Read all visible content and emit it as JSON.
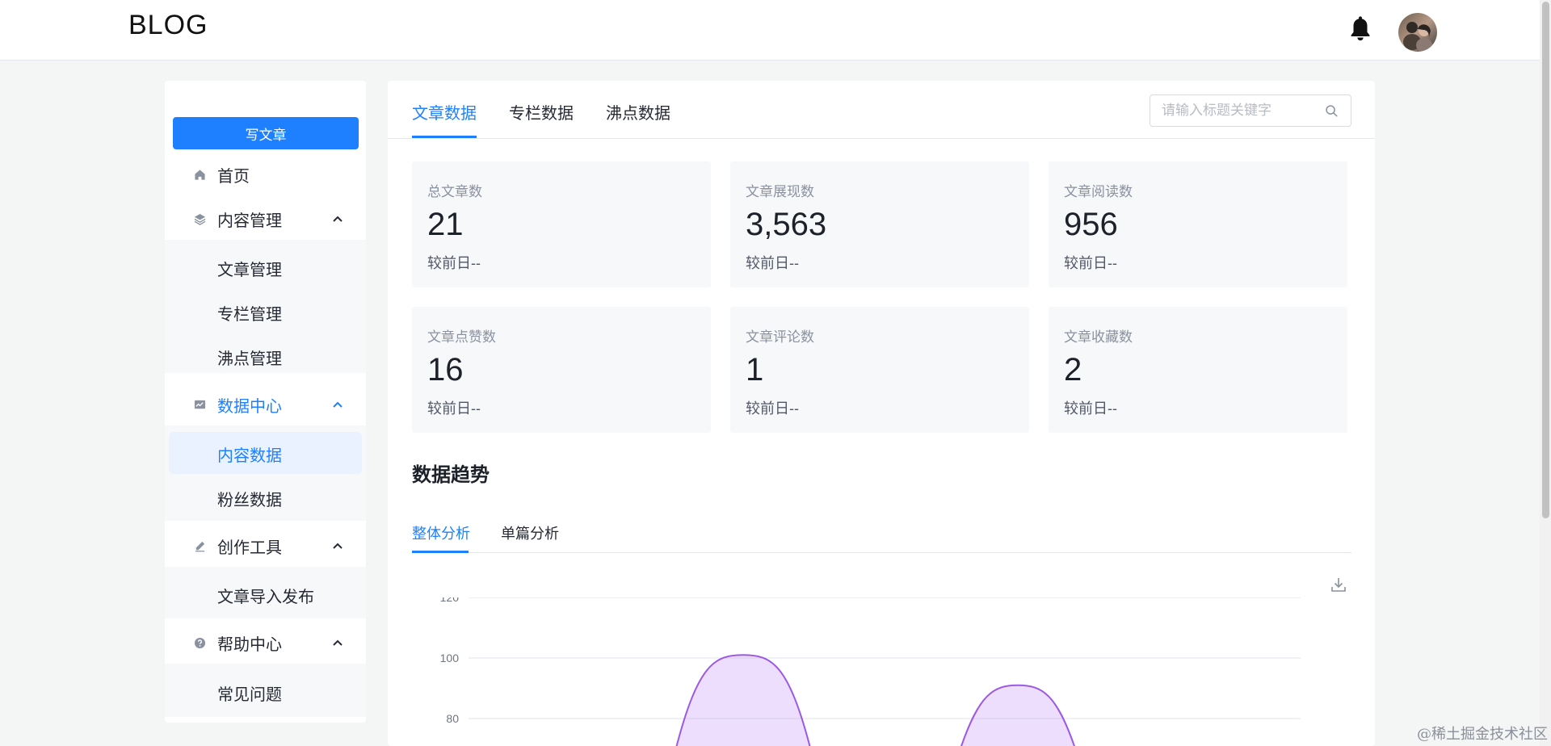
{
  "header": {
    "logo": "BLOG",
    "bell_icon": "bell-icon",
    "avatar": "user-avatar"
  },
  "sidebar": {
    "write_button": "写文章",
    "home": "首页",
    "content_mgmt": {
      "label": "内容管理",
      "items": [
        "文章管理",
        "专栏管理",
        "沸点管理"
      ]
    },
    "data_center": {
      "label": "数据中心",
      "items": [
        "内容数据",
        "粉丝数据"
      ]
    },
    "creation_tools": {
      "label": "创作工具",
      "items": [
        "文章导入发布"
      ]
    },
    "help_center": {
      "label": "帮助中心",
      "items": [
        "常见问题"
      ]
    }
  },
  "main": {
    "tabs": [
      "文章数据",
      "专栏数据",
      "沸点数据"
    ],
    "active_tab": 0,
    "search_placeholder": "请输入标题关键字",
    "stats": [
      {
        "label": "总文章数",
        "value": "21",
        "sub": "较前日--"
      },
      {
        "label": "文章展现数",
        "value": "3,563",
        "sub": "较前日--"
      },
      {
        "label": "文章阅读数",
        "value": "956",
        "sub": "较前日--"
      },
      {
        "label": "文章点赞数",
        "value": "16",
        "sub": "较前日--"
      },
      {
        "label": "文章评论数",
        "value": "1",
        "sub": "较前日--"
      },
      {
        "label": "文章收藏数",
        "value": "2",
        "sub": "较前日--"
      }
    ],
    "trend_title": "数据趋势",
    "subtabs": [
      "整体分析",
      "单篇分析"
    ]
  },
  "chart_data": {
    "type": "area",
    "y_ticks": [
      "120",
      "100",
      "80"
    ],
    "ylim": [
      80,
      120
    ],
    "visible_peaks": [
      101,
      91
    ],
    "series_color": "#9b59e6"
  },
  "watermark": "@稀土掘金技术社区"
}
